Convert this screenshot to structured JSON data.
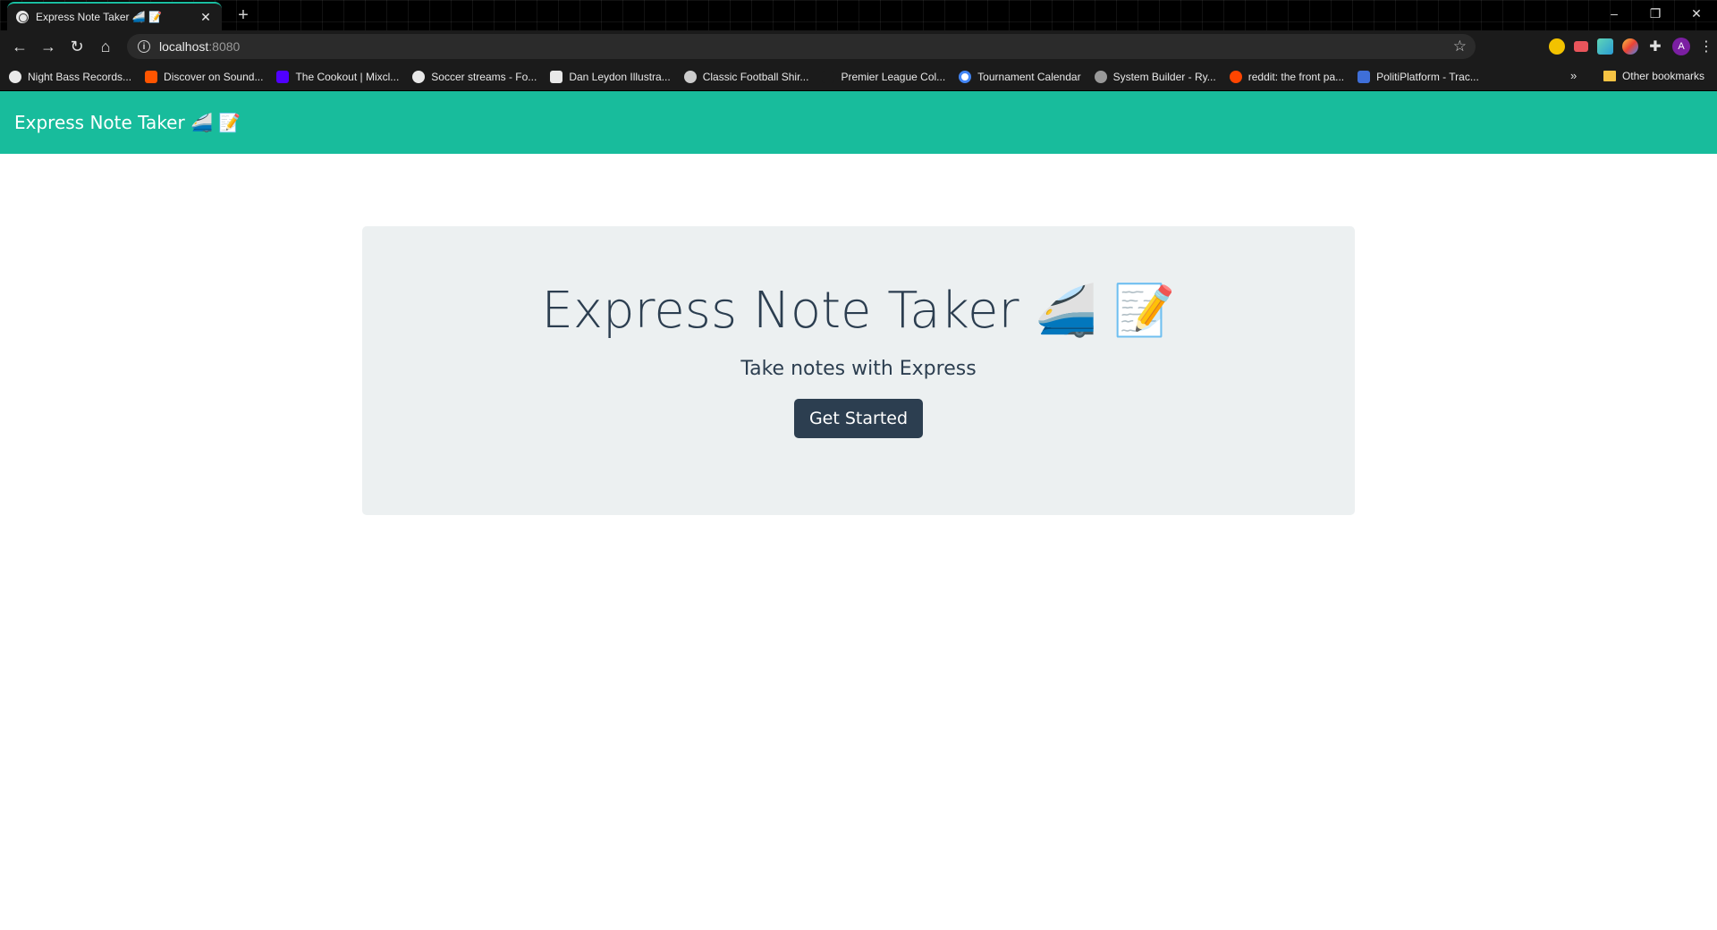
{
  "browser": {
    "tab": {
      "title": "Express Note Taker 🚄 📝",
      "close": "✕"
    },
    "new_tab": "+",
    "window_controls": {
      "minimize": "–",
      "restore": "❐",
      "close": "✕"
    },
    "nav": {
      "back": "←",
      "forward": "→",
      "reload": "↻",
      "home": "⌂"
    },
    "address": {
      "host": "localhost",
      "port": ":8080",
      "info": "i",
      "star": "☆"
    },
    "extensions": [
      "yellow-circle-icon",
      "red-arrow-icon",
      "pen-icon",
      "color-picker-icon",
      "puzzle-icon"
    ],
    "profile_initial": "A",
    "menu": "⋮",
    "bookmarks": [
      {
        "label": "Night Bass Records...",
        "icon_color": "#222222"
      },
      {
        "label": "Discover on Sound...",
        "icon_color": "#ff5500"
      },
      {
        "label": "The Cookout | Mixcl...",
        "icon_color": "#5000ff"
      },
      {
        "label": "Soccer streams - Fo...",
        "icon_color": "#e8e8e8"
      },
      {
        "label": "Dan Leydon Illustra...",
        "icon_color": "#e8e8e8"
      },
      {
        "label": "Classic Football Shir...",
        "icon_color": "#cccccc"
      },
      {
        "label": "Premier League Col...",
        "icon_color": "#1b1b1b"
      },
      {
        "label": "Tournament Calendar",
        "icon_color": "#4285f4"
      },
      {
        "label": "System Builder - Ry...",
        "icon_color": "#999999"
      },
      {
        "label": "reddit: the front pa...",
        "icon_color": "#ff4500"
      },
      {
        "label": "PolitiPlatform - Trac...",
        "icon_color": "#3f6fd8"
      }
    ],
    "bookmarks_more": "»",
    "other_bookmarks": "Other bookmarks"
  },
  "navbar": {
    "brand": "Express Note Taker 🚄 📝"
  },
  "hero": {
    "title": "Express Note Taker 🚄 📝",
    "subtitle": "Take notes with Express",
    "button": "Get Started"
  },
  "colors": {
    "navbar": "#18bc9c",
    "jumbotron": "#ecf0f1",
    "primary": "#2c3e50"
  }
}
